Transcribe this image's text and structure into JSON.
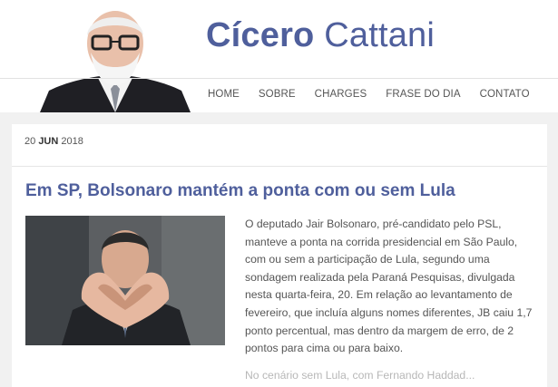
{
  "site": {
    "title_first": "Cícero",
    "title_last": "Cattani"
  },
  "nav": {
    "items": [
      "HOME",
      "SOBRE",
      "CHARGES",
      "FRASE DO DIA",
      "CONTATO"
    ]
  },
  "post": {
    "date_day": "20",
    "date_month": "JUN",
    "date_year": "2018",
    "title": "Em SP, Bolsonaro mantém a ponta com ou sem Lula",
    "excerpt": "O deputado Jair Bolsonaro, pré-candidato pelo PSL, manteve a ponta na corrida presidencial em São Paulo, com ou sem a participação de Lula, segundo uma sondagem realizada pela Paraná Pesquisas, divulgada nesta quarta-feira, 20. Em relação ao levantamento de fevereiro, que incluía alguns nomes diferentes, JB caiu 1,7 ponto percentual, mas dentro da margem de erro, de 2 pontos para cima ou para baixo.",
    "more_text": "No cenário sem Lula, com Fernando Haddad..."
  }
}
